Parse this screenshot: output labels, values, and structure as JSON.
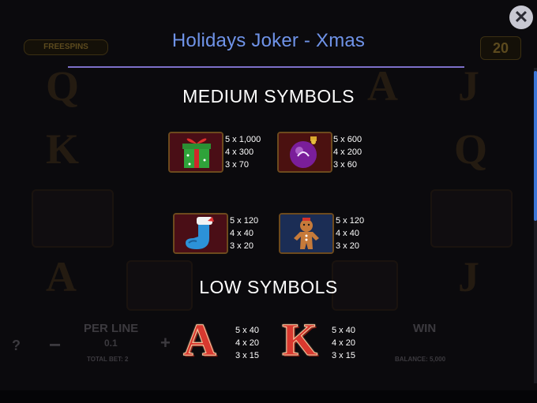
{
  "window": {
    "title": "Holidays Joker - Xmas",
    "close_icon": "close-icon"
  },
  "background": {
    "freespins_badge": "FREESPINS",
    "lines_count": "20",
    "per_line_label": "PER LINE",
    "per_line_value": "0.1",
    "total_bet": "TOTAL BET: 2",
    "win_label": "WIN",
    "balance": "BALANCE: 5,000",
    "minus": "−",
    "plus": "+",
    "help": "?"
  },
  "medium": {
    "heading": "MEDIUM SYMBOLS",
    "items": [
      {
        "icon": "gift-icon",
        "pays": [
          "5 x 1,000",
          "4 x 300",
          "3 x 70"
        ]
      },
      {
        "icon": "ornament-icon",
        "pays": [
          "5 x 600",
          "4 x 200",
          "3 x 60"
        ]
      },
      {
        "icon": "stocking-icon",
        "pays": [
          "5 x 120",
          "4 x 40",
          "3 x 20"
        ]
      },
      {
        "icon": "gingerbread-icon",
        "pays": [
          "5 x 120",
          "4 x 40",
          "3 x 20"
        ]
      }
    ]
  },
  "low": {
    "heading": "LOW SYMBOLS",
    "items": [
      {
        "letter": "A",
        "pays": [
          "5 x 40",
          "4 x 20",
          "3 x 15"
        ]
      },
      {
        "letter": "K",
        "pays": [
          "5 x 40",
          "4 x 20",
          "3 x 15"
        ]
      }
    ]
  },
  "colors": {
    "title": "#6f93e8",
    "rule": "#7d6fc9",
    "scroll_thumb": "#3c76d6",
    "letter_red": "#d8392f"
  }
}
